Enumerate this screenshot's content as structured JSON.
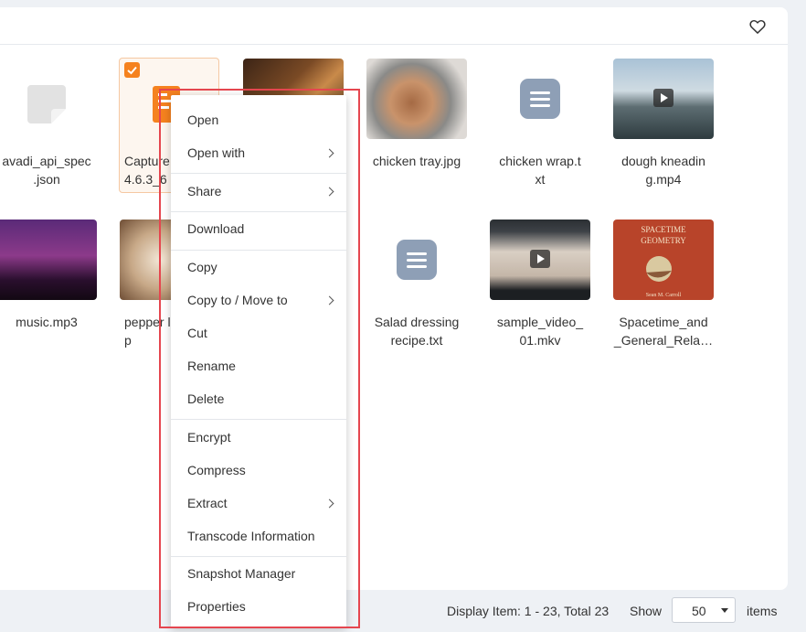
{
  "files": [
    {
      "name": "avadi_api_spec\n.json",
      "kind": "json"
    },
    {
      "name": "Capture\n4.6.3_6",
      "kind": "capture",
      "selected": true
    },
    {
      "name": "",
      "kind": "photo-food"
    },
    {
      "name": "chicken tray.jpg",
      "kind": "photo-chicken"
    },
    {
      "name": "chicken wrap.t\nxt",
      "kind": "text-icon"
    },
    {
      "name": "dough kneadin\ng.mp4",
      "kind": "video-harbor"
    },
    {
      "name": "music.mp3",
      "kind": "photo-purple"
    },
    {
      "name": "pepper l\np",
      "kind": "photo-pepper"
    },
    {
      "name": "Salad dressing\nrecipe.txt",
      "kind": "text-icon"
    },
    {
      "name": "sample_video_\n01.mkv",
      "kind": "video-person"
    },
    {
      "name": "Spacetime_and\n_General_Rela…",
      "kind": "book-cover"
    }
  ],
  "book_cover": {
    "title_line1": "SPACETIME",
    "title_line2": "GEOMETRY",
    "author": "Sean M. Carroll"
  },
  "context_menu": {
    "groups": [
      [
        {
          "label": "Open"
        },
        {
          "label": "Open with",
          "submenu": true
        }
      ],
      [
        {
          "label": "Share",
          "submenu": true
        }
      ],
      [
        {
          "label": "Download"
        }
      ],
      [
        {
          "label": "Copy"
        },
        {
          "label": "Copy to / Move to",
          "submenu": true
        },
        {
          "label": "Cut"
        },
        {
          "label": "Rename"
        },
        {
          "label": "Delete"
        }
      ],
      [
        {
          "label": "Encrypt"
        },
        {
          "label": "Compress"
        },
        {
          "label": "Extract",
          "submenu": true
        },
        {
          "label": "Transcode Information"
        }
      ],
      [
        {
          "label": "Snapshot Manager"
        },
        {
          "label": "Properties"
        }
      ]
    ]
  },
  "footer": {
    "display_text": "Display Item: 1 - 23, Total 23",
    "show_label": "Show",
    "page_size": "50",
    "items_label": "items"
  },
  "icons": {
    "favorite": "heart-icon",
    "submenu": "chevron-right-icon",
    "dropdown": "caret-down-icon"
  },
  "colors": {
    "accent": "#f5821f",
    "highlight_border": "#e5464f",
    "text_icon": "#8e9fb6"
  }
}
